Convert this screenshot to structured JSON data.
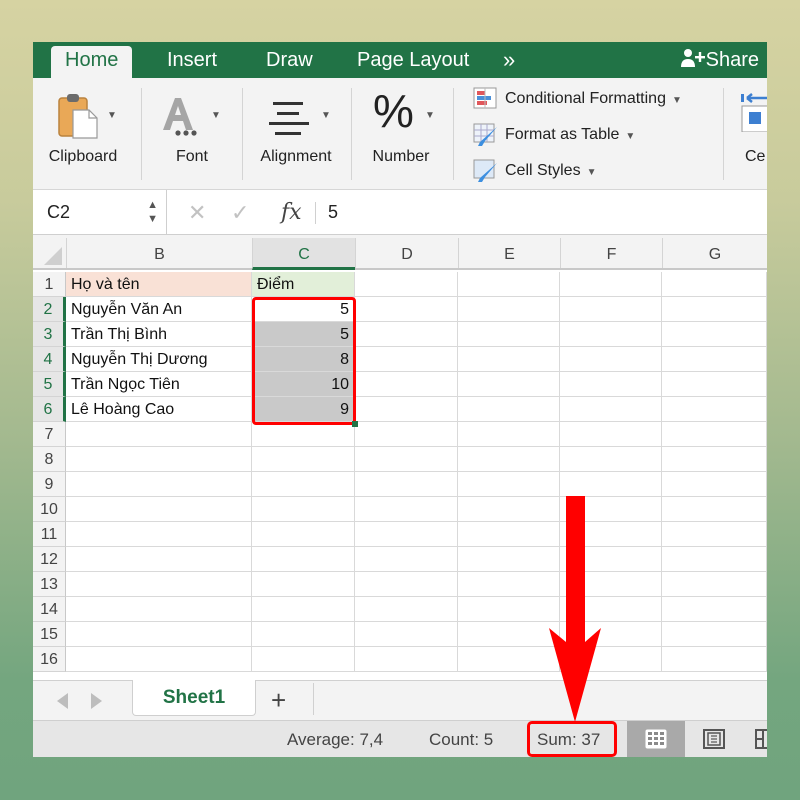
{
  "ribbon_tabs": [
    {
      "label": "Home",
      "active": true
    },
    {
      "label": "Insert",
      "active": false
    },
    {
      "label": "Draw",
      "active": false
    },
    {
      "label": "Page Layout",
      "active": false
    }
  ],
  "more_tabs_label": "»",
  "share_label": "Share",
  "ribbon_groups": {
    "clipboard": "Clipboard",
    "font": "Font",
    "alignment": "Alignment",
    "number": "Number",
    "number_icon": "%",
    "cells_partial": "Ce"
  },
  "styles_group": [
    {
      "label": "Conditional Formatting",
      "icon": "conditional-formatting-icon"
    },
    {
      "label": "Format as Table",
      "icon": "format-as-table-icon"
    },
    {
      "label": "Cell Styles",
      "icon": "cell-styles-icon"
    }
  ],
  "formula_bar": {
    "name_box": "C2",
    "cancel_glyph": "✕",
    "enter_glyph": "✓",
    "fx_label": "fx",
    "value": "5"
  },
  "columns": [
    "B",
    "C",
    "D",
    "E",
    "F",
    "G"
  ],
  "selected_column": "C",
  "rows": [
    "1",
    "2",
    "3",
    "4",
    "5",
    "6",
    "7",
    "8",
    "9",
    "10",
    "11",
    "12",
    "13",
    "14",
    "15",
    "16"
  ],
  "selected_rows": [
    "2",
    "3",
    "4",
    "5",
    "6"
  ],
  "table": {
    "header": {
      "name": "Họ và tên",
      "score": "Điểm"
    },
    "records": [
      {
        "name": "Nguyễn Văn An",
        "score": "5"
      },
      {
        "name": "Trần Thị Bình",
        "score": "5"
      },
      {
        "name": "Nguyễn Thị Dương",
        "score": "8"
      },
      {
        "name": "Trần Ngọc Tiên",
        "score": "10"
      },
      {
        "name": "Lê Hoàng Cao",
        "score": "9"
      }
    ]
  },
  "sheet_tabs": {
    "active": "Sheet1",
    "add_label": "+"
  },
  "status_bar": {
    "average": "Average: 7,4",
    "count": "Count: 5",
    "sum": "Sum: 37"
  },
  "colors": {
    "excel_green": "#217346",
    "highlight_red": "#ff0000",
    "header_b_fill": "#f9e1d6",
    "header_c_fill": "#e2efd9",
    "selection_fill": "#c9c9c9"
  }
}
